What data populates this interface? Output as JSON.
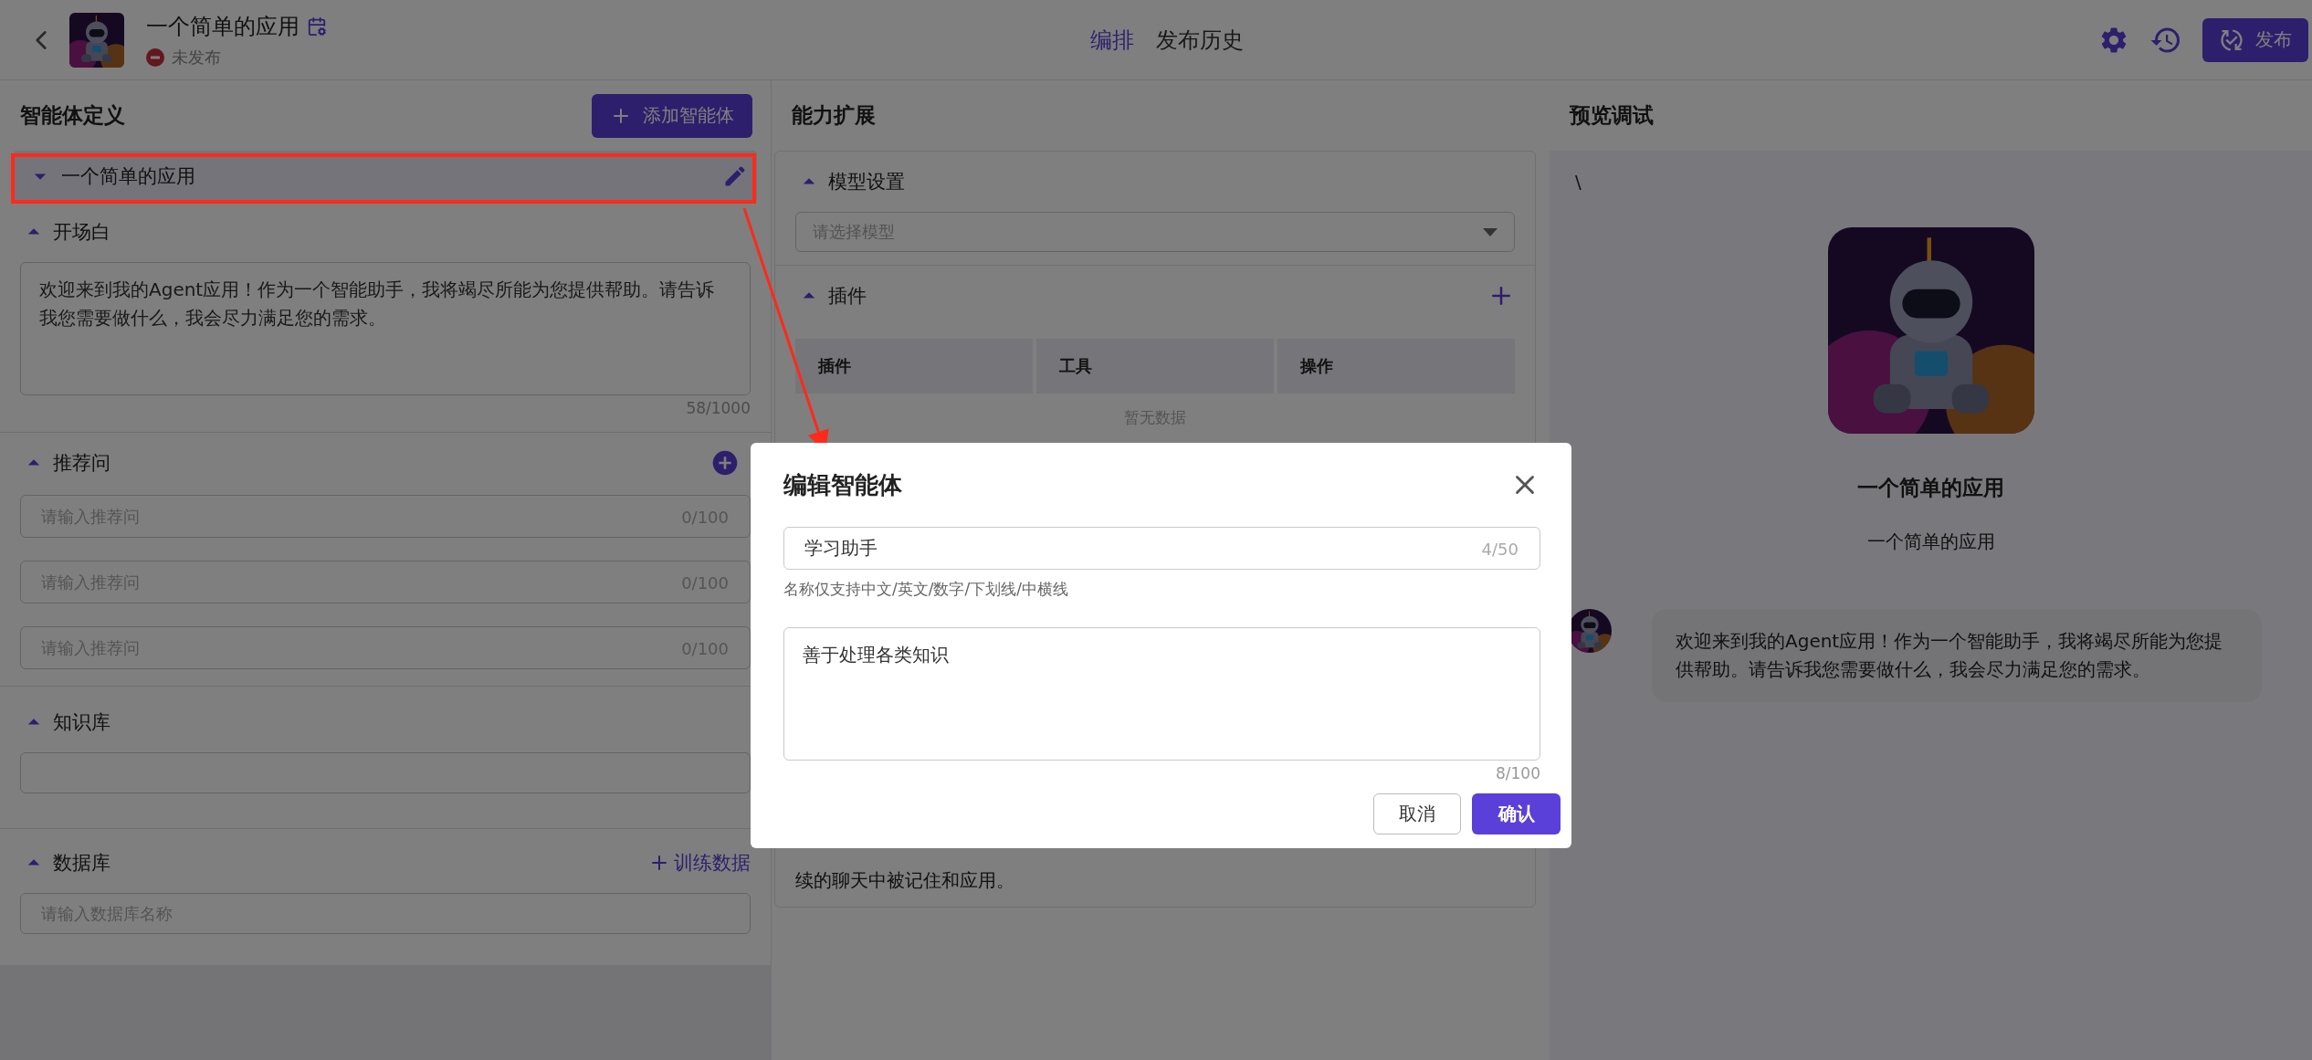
{
  "header": {
    "title": "一个简单的应用",
    "status": "未发布",
    "tabs": [
      {
        "label": "编排",
        "selected": true
      },
      {
        "label": "发布历史",
        "selected": false
      }
    ],
    "publish_button": "发布"
  },
  "definition": {
    "title": "智能体定义",
    "add_button": "添加智能体",
    "agent_name": "一个简单的应用",
    "opening": {
      "title": "开场白",
      "value": "欢迎来到我的Agent应用！作为一个智能助手，我将竭尽所能为您提供帮助。请告诉我您需要做什么，我会尽力满足您的需求。",
      "counter": "58/1000"
    },
    "suggestions": {
      "title": "推荐问",
      "fields": [
        {
          "placeholder": "请输入推荐问",
          "counter": "0/100"
        },
        {
          "placeholder": "请输入推荐问",
          "counter": "0/100"
        },
        {
          "placeholder": "请输入推荐问",
          "counter": "0/100"
        }
      ]
    },
    "knowledge": {
      "title": "知识库"
    },
    "database": {
      "title": "数据库",
      "link": "训练数据",
      "placeholder": "请输入数据库名称"
    }
  },
  "capabilities": {
    "title": "能力扩展",
    "model": {
      "title": "模型设置",
      "placeholder": "请选择模型"
    },
    "plugins": {
      "title": "插件",
      "columns": [
        "插件",
        "工具",
        "操作"
      ],
      "empty": "暂无数据"
    },
    "memory_text": "续的聊天中被记住和应用。"
  },
  "preview": {
    "title": "预览调试",
    "stray_text": "\\",
    "name": "一个简单的应用",
    "subtitle": "一个简单的应用",
    "messages": [
      {
        "text": "欢迎来到我的Agent应用！作为一个智能助手，我将竭尽所能为您提供帮助。请告诉我您需要做什么，我会尽力满足您的需求。"
      }
    ]
  },
  "dialog": {
    "title": "编辑智能体",
    "name_value": "学习助手",
    "name_counter": "4/50",
    "hint": "名称仅支持中文/英文/数字/下划线/中横线",
    "description": "善于处理各类知识",
    "description_counter": "8/100",
    "cancel": "取消",
    "confirm": "确认"
  }
}
